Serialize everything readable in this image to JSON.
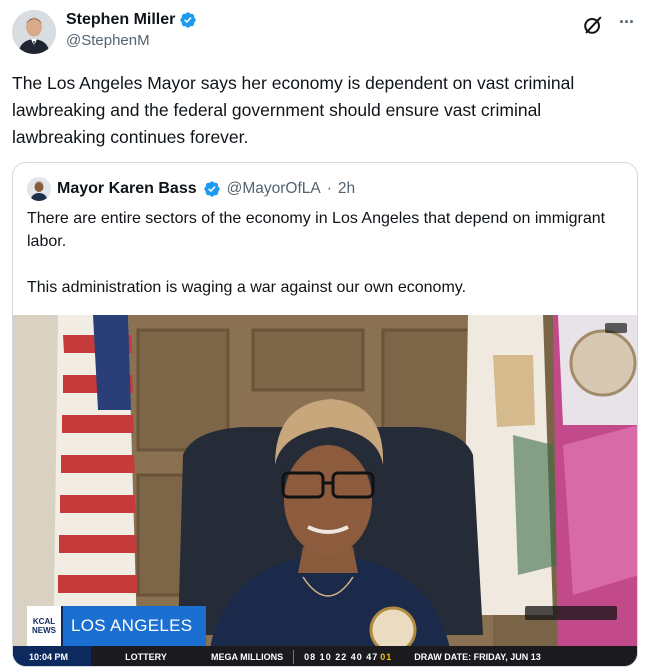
{
  "author": {
    "display_name": "Stephen Miller",
    "handle": "@StephenM",
    "verified": true
  },
  "tweet": {
    "text": "The Los Angeles Mayor says her economy is dependent on vast criminal lawbreaking and the federal government should ensure vast criminal lawbreaking continues forever."
  },
  "quoted": {
    "display_name": "Mayor Karen Bass",
    "handle": "@MayorOfLA",
    "time": "2h",
    "separator": "·",
    "paragraph1": "There are entire sectors of the economy in Los Angeles that depend on immigrant labor.",
    "paragraph2": "This administration is waging a war against our own economy."
  },
  "video": {
    "network_line1": "KCAL",
    "network_line2": "NEWS",
    "location": "LOS ANGELES",
    "ticker_time": "10:04 PM",
    "ticker_category": "LOTTERY",
    "ticker_game": "MEGA MILLIONS",
    "ticker_numbers": "08 10 22 40 47",
    "ticker_mega": "01",
    "ticker_draw": "DRAW DATE: FRIDAY, JUN 13"
  },
  "icons": {
    "verified": "verified-badge-icon",
    "grok": "grok-icon",
    "more": "more-icon"
  },
  "colors": {
    "verified_blue": "#1d9bf0",
    "text_secondary": "#536471",
    "location_blue": "#1b6fd1"
  }
}
